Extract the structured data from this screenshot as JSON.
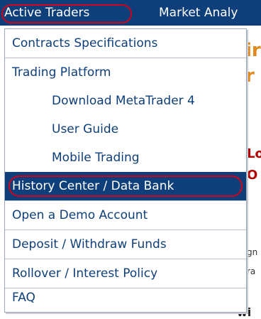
{
  "nav": {
    "active_label": "Active Traders",
    "next_label": "Market Analy"
  },
  "background": {
    "frag1": "ir",
    "frag2": "r",
    "frag3": "Lo",
    "frag4": "O",
    "frag5": "gn",
    "frag6": "ra",
    "frag7": "wi"
  },
  "menu": {
    "items": [
      {
        "label": "Contracts Specifications"
      },
      {
        "label": "Trading Platform"
      },
      {
        "label": "Download MetaTrader 4"
      },
      {
        "label": "User Guide"
      },
      {
        "label": "Mobile Trading"
      },
      {
        "label": "History Center / Data Bank"
      },
      {
        "label": "Open a Demo Account"
      },
      {
        "label": "Deposit / Withdraw Funds"
      },
      {
        "label": "Rollover / Interest Policy"
      },
      {
        "label": "FAQ"
      }
    ]
  },
  "colors": {
    "nav_bg": "#0f3f7a",
    "highlight_ring": "#d0021b",
    "menu_text": "#0f3f7a"
  }
}
